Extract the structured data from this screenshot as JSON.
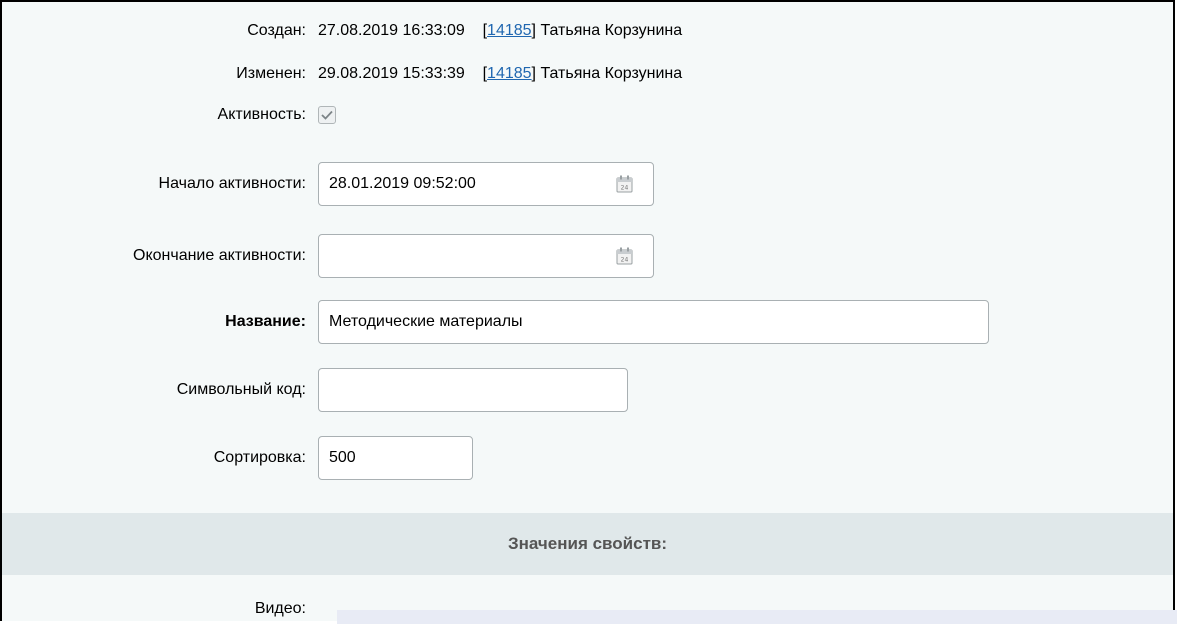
{
  "created": {
    "label": "Создан:",
    "datetime": "27.08.2019 16:33:09",
    "user_id_open": "[",
    "user_id": "14185",
    "user_id_close": "]",
    "user_name": "Татьяна Корзунина"
  },
  "modified": {
    "label": "Изменен:",
    "datetime": "29.08.2019 15:33:39",
    "user_id_open": "[",
    "user_id": "14185",
    "user_id_close": "]",
    "user_name": "Татьяна Корзунина"
  },
  "active": {
    "label": "Активность:",
    "checked": true
  },
  "active_from": {
    "label": "Начало активности:",
    "value": "28.01.2019 09:52:00"
  },
  "active_to": {
    "label": "Окончание активности:",
    "value": ""
  },
  "name": {
    "label": "Название:",
    "value": "Методические материалы"
  },
  "code": {
    "label": "Символьный код:",
    "value": ""
  },
  "sort": {
    "label": "Сортировка:",
    "value": "500"
  },
  "properties": {
    "title": "Значения свойств:"
  },
  "video": {
    "label": "Видео:"
  },
  "colors": {
    "link": "#2067b0",
    "section_bg": "#e0e8ea",
    "panel_bg": "#f5f9f9"
  },
  "icons": {
    "calendar": "calendar-icon",
    "check": "checkmark-icon"
  }
}
